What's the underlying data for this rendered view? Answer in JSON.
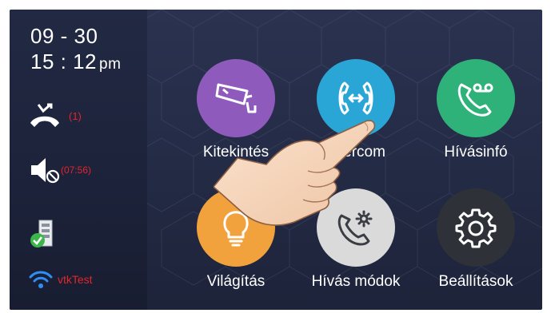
{
  "status": {
    "date": "09 - 30",
    "time": "15 : 12",
    "ampm": "pm",
    "missed_calls": "(1)",
    "mute_timer": "(07:56)",
    "wifi_name": "vtkTest"
  },
  "apps": [
    {
      "label": "Kitekintés",
      "icon": "cctv-camera-icon",
      "color": "#8e5bbd"
    },
    {
      "label": "Intercom",
      "icon": "intercom-handset-icon",
      "color": "#2aa6d6"
    },
    {
      "label": "Hívásinfó",
      "icon": "voicemail-phone-icon",
      "color": "#2fb27a"
    },
    {
      "label": "Világítás",
      "icon": "light-bulb-icon",
      "color": "#f2a23c"
    },
    {
      "label": "Hívás módok",
      "icon": "phone-settings-icon",
      "color": "#dadada"
    },
    {
      "label": "Beállítások",
      "icon": "gear-icon",
      "color": "#2e3138"
    }
  ]
}
